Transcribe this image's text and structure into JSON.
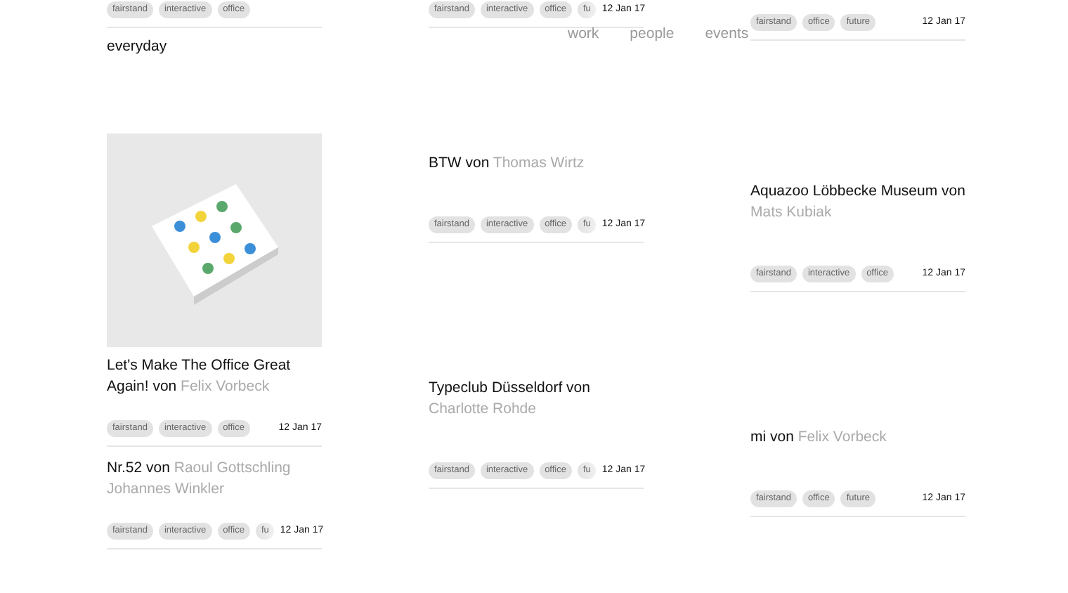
{
  "nav": [
    "work",
    "people",
    "events"
  ],
  "columns": [
    {
      "cards": [
        {
          "tags": [
            "fairstand",
            "interactive",
            "office"
          ]
        },
        {
          "title": "everyday"
        },
        {
          "image": true,
          "title": "Let's Make The Office Great Again! von",
          "author": "Felix Vorbeck",
          "tags": [
            "fairstand",
            "interactive",
            "office"
          ],
          "date": "12 Jan 17"
        },
        {
          "title": "Nr.52 von",
          "author": "Raoul Gottschling Johannes Winkler",
          "tags": [
            "fairstand",
            "interactive",
            "office",
            "fu"
          ],
          "date": "12 Jan 17"
        }
      ]
    },
    {
      "cards": [
        {
          "tags": [
            "fairstand",
            "interactive",
            "office",
            "fu"
          ],
          "date": "12 Jan 17"
        },
        {
          "title": "BTW von",
          "author": "Thomas Wirtz",
          "tags": [
            "fairstand",
            "interactive",
            "office",
            "fu"
          ],
          "date": "12 Jan 17"
        },
        {
          "title": "Typeclub Düsseldorf von",
          "author": "Charlotte Rohde",
          "tags": [
            "fairstand",
            "interactive",
            "office",
            "fu"
          ],
          "date": "12 Jan 17"
        }
      ]
    },
    {
      "cards": [
        {
          "tags": [
            "fairstand",
            "office",
            "future"
          ],
          "date": "12 Jan 17"
        },
        {
          "title": "Aquazoo Löbbecke Museum von",
          "author": "Mats Kubiak",
          "tags": [
            "fairstand",
            "interactive",
            "office"
          ],
          "date": "12 Jan 17"
        },
        {
          "title": "mi von",
          "author": "Felix Vorbeck",
          "tags": [
            "fairstand",
            "office",
            "future"
          ],
          "date": "12 Jan 17"
        }
      ]
    }
  ]
}
